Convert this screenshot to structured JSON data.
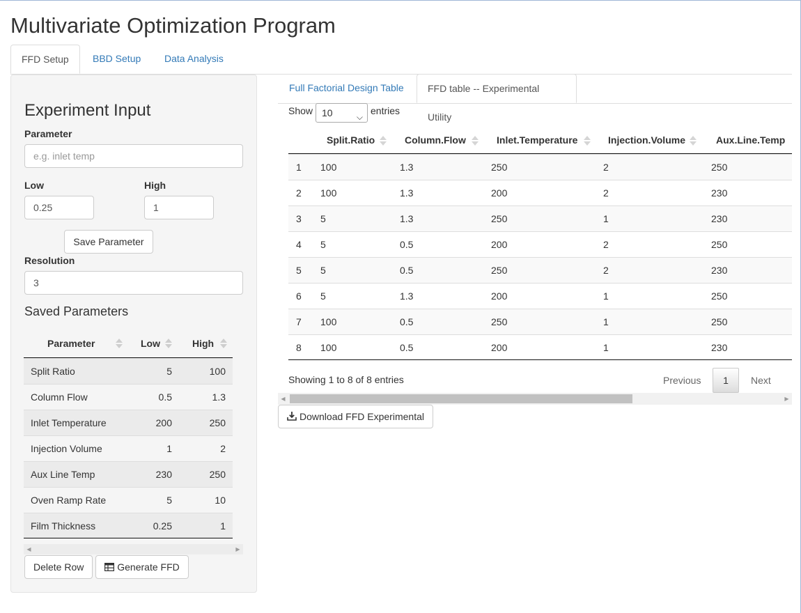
{
  "app": {
    "title": "Multivariate Optimization Program"
  },
  "tabs": [
    "FFD Setup",
    "BBD Setup",
    "Data Analysis"
  ],
  "sidebar": {
    "heading": "Experiment Input",
    "parameter_label": "Parameter",
    "parameter_placeholder": "e.g. inlet temp",
    "low_label": "Low",
    "low_value": "0.25",
    "high_label": "High",
    "high_value": "1",
    "save_button": "Save Parameter",
    "resolution_label": "Resolution",
    "resolution_value": "3",
    "saved_heading": "Saved Parameters",
    "saved_columns": [
      "Parameter",
      "Low",
      "High"
    ],
    "saved_rows": [
      [
        "Split Ratio",
        "5",
        "100"
      ],
      [
        "Column Flow",
        "0.5",
        "1.3"
      ],
      [
        "Inlet Temperature",
        "200",
        "250"
      ],
      [
        "Injection Volume",
        "1",
        "2"
      ],
      [
        "Aux Line Temp",
        "230",
        "250"
      ],
      [
        "Oven Ramp Rate",
        "5",
        "10"
      ],
      [
        "Film Thickness",
        "0.25",
        "1"
      ]
    ],
    "delete_button": "Delete Row",
    "generate_button": "Generate FFD"
  },
  "right": {
    "tabs": [
      "Full Factorial Design Table",
      "FFD table -- Experimental Utility"
    ],
    "show_label": "Show",
    "page_size": "10",
    "entries_label": "entries",
    "columns": [
      "",
      "Split.Ratio",
      "Column.Flow",
      "Inlet.Temperature",
      "Injection.Volume",
      "Aux.Line.Temp"
    ],
    "rows": [
      [
        "1",
        "100",
        "1.3",
        "250",
        "2",
        "250"
      ],
      [
        "2",
        "100",
        "1.3",
        "200",
        "2",
        "230"
      ],
      [
        "3",
        "5",
        "1.3",
        "250",
        "1",
        "230"
      ],
      [
        "4",
        "5",
        "0.5",
        "200",
        "2",
        "250"
      ],
      [
        "5",
        "5",
        "0.5",
        "250",
        "2",
        "230"
      ],
      [
        "6",
        "5",
        "1.3",
        "200",
        "1",
        "250"
      ],
      [
        "7",
        "100",
        "0.5",
        "250",
        "1",
        "250"
      ],
      [
        "8",
        "100",
        "0.5",
        "200",
        "1",
        "230"
      ]
    ],
    "info": "Showing 1 to 8 of 8 entries",
    "previous": "Previous",
    "current_page": "1",
    "next": "Next",
    "download_button": "Download FFD Experimental"
  }
}
